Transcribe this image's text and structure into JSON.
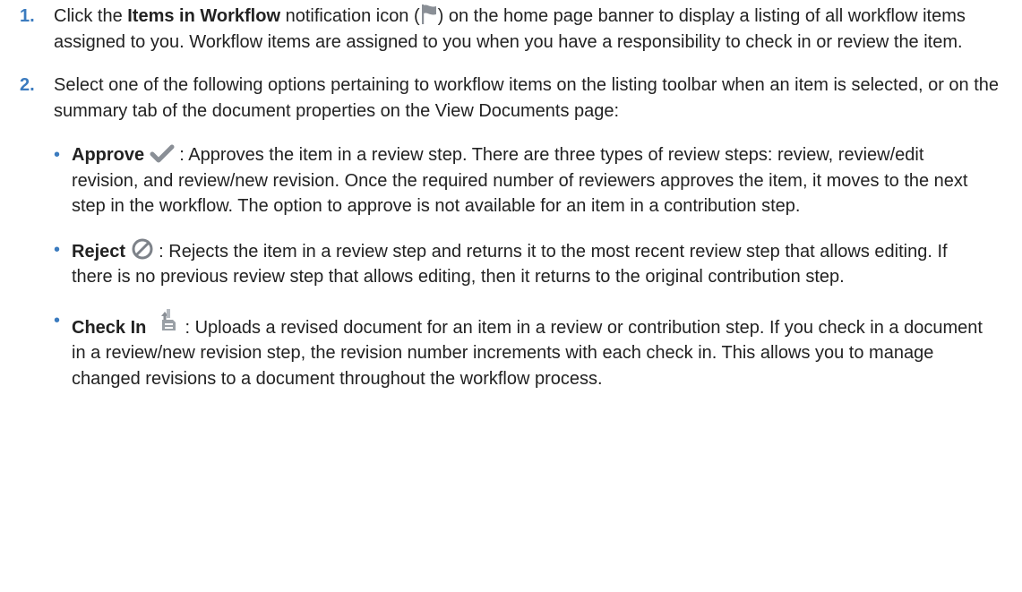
{
  "steps": [
    {
      "number": "1.",
      "pre": "Click the ",
      "bold": "Items in Workflow",
      "mid": " notification icon (",
      "icon": "flag-icon",
      "post": ") on the home page banner to display a listing of all workflow items assigned to you. Workflow items are assigned to you when you have a responsibility to check in or review the item."
    },
    {
      "number": "2.",
      "text": "Select one of the following options pertaining to workflow items on the listing toolbar when an item is selected, or on the summary tab of the document properties on the View Documents page:"
    }
  ],
  "options": [
    {
      "bullet": "•",
      "label": "Approve",
      "icon": "checkmark-icon",
      "description": " : Approves the item in a review step. There are three types of review steps: review, review/edit revision, and review/new revision. Once the required number of reviewers approves the item, it moves to the next step in the workflow. The option to approve is not available for an item in a contribution step."
    },
    {
      "bullet": "•",
      "label": "Reject",
      "icon": "prohibit-icon",
      "description": " : Rejects the item in a review step and returns it to the most recent review step that allows editing. If there is no previous review step that allows editing, then it returns to the original contribution step."
    },
    {
      "bullet": "•",
      "label": "Check In",
      "icon": "check-in-icon",
      "description": " : Uploads a revised document for an item in a review or contribution step. If you check in a document in a review/new revision step, the revision number increments with each check in. This allows you to manage changed revisions to a document throughout the workflow process."
    }
  ],
  "colors": {
    "accent": "#3b7bbf",
    "text": "#222222",
    "icon_gray": "#8a8f96"
  }
}
